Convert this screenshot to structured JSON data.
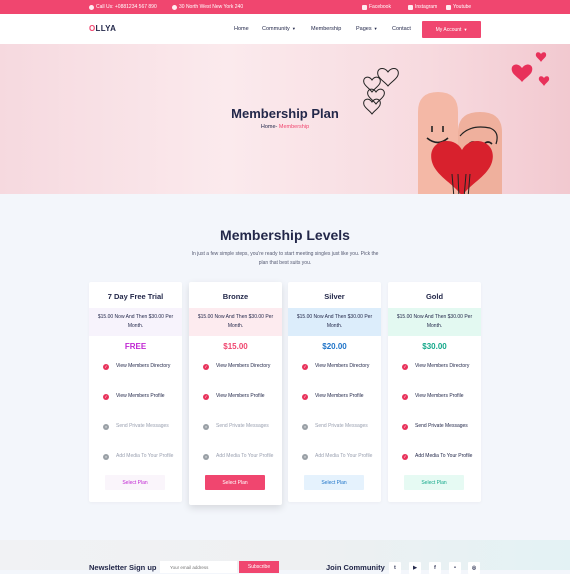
{
  "topbar": {
    "phone": "Call Us: +0881234 567 890",
    "address": "30 North West New York 240",
    "facebook": "Facebook",
    "instagram": "Instagram",
    "youtube": "Youtube"
  },
  "header": {
    "logo_o": "O",
    "logo_rest": "LLYA",
    "nav": [
      "Home",
      "Community",
      "Membership",
      "Pages",
      "Contact"
    ],
    "account_button": "My Account"
  },
  "hero": {
    "title": "Membership Plan",
    "crumb_home": "Home-",
    "crumb_current": " Membership"
  },
  "section": {
    "title": "Membership Levels",
    "description": "In just a few simple steps, you're ready to start meeting singles just like you. Pick the plan that best suits you."
  },
  "plans": [
    {
      "name": "7 Day Free Trial",
      "price_text": "$15.00 Now And Then $30.00 Per Month.",
      "amount": "FREE",
      "button": "Select Plan",
      "accent": "#c026d3",
      "band": "#f7f3fc",
      "btn_bg": "#faf5fb",
      "btn_color": "#c026d3"
    },
    {
      "name": "Bronze",
      "price_text": "$15.00 Now And Then $30.00 Per Month.",
      "amount": "$15.00",
      "button": "Select Plan",
      "accent": "#f0466f",
      "band": "#fdebef",
      "btn_bg": "#f0466f",
      "btn_color": "#ffffff"
    },
    {
      "name": "Silver",
      "price_text": "$15.00 Now And Then $30.00 Per Month.",
      "amount": "$20.00",
      "button": "Select Plan",
      "accent": "#1f74c8",
      "band": "#dcedfb",
      "btn_bg": "#e5f2fd",
      "btn_color": "#1f74c8"
    },
    {
      "name": "Gold",
      "price_text": "$15.00 Now And Then $30.00 Per Month.",
      "amount": "$30.00",
      "button": "Select Plan",
      "accent": "#14a88a",
      "band": "#e3f9f1",
      "btn_bg": "#e6faf3",
      "btn_color": "#14a88a"
    }
  ],
  "features": [
    {
      "label": "View Members Directory",
      "included": [
        true,
        true,
        true,
        true
      ]
    },
    {
      "label": "View Members Profile",
      "included": [
        true,
        true,
        true,
        true
      ]
    },
    {
      "label": "Send Private Messages",
      "included": [
        false,
        false,
        false,
        true
      ]
    },
    {
      "label": "Add Media To Your Profile",
      "included": [
        false,
        false,
        false,
        true
      ]
    }
  ],
  "footer": {
    "newsletter_title": "Newsletter Sign up",
    "email_placeholder": "Your email address",
    "subscribe": "Subscribe",
    "community_title": "Join Community",
    "social_icons": [
      "twitter-icon",
      "youtube-icon",
      "facebook-icon",
      "flickr-icon",
      "instagram-icon"
    ]
  }
}
